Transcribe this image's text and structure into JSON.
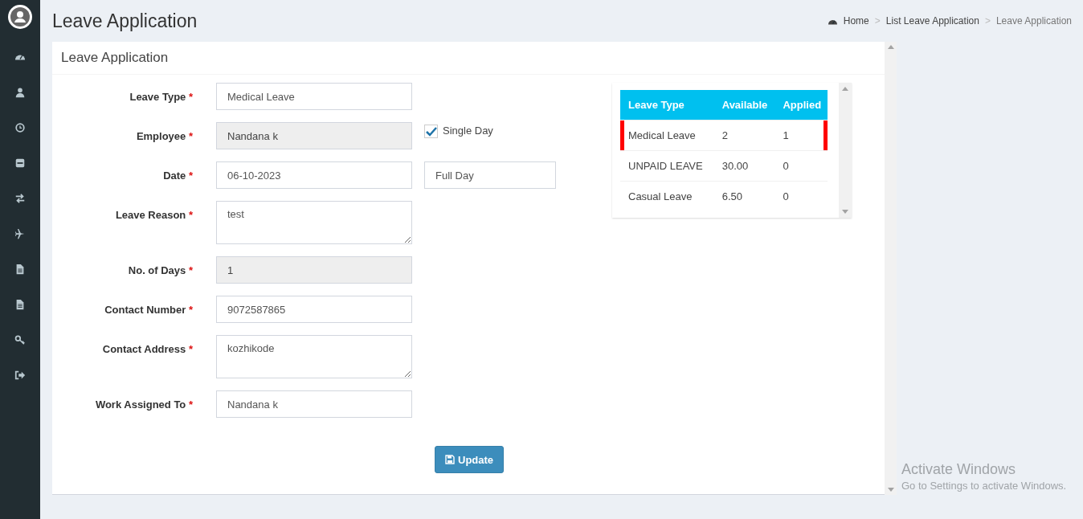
{
  "page_title": "Leave Application",
  "breadcrumb": [
    {
      "label": "Home",
      "kind": "link"
    },
    {
      "label": "List Leave Application",
      "kind": "link"
    },
    {
      "label": "Leave Application",
      "kind": "current"
    }
  ],
  "breadcrumb_separator": ">",
  "card_title": "Leave Application",
  "required_mark": "*",
  "fields": [
    {
      "label": "Leave Type",
      "kind": "input",
      "value": "Medical Leave",
      "disabled": false
    },
    {
      "label": "Employee",
      "kind": "input",
      "value": "Nandana k",
      "disabled": true,
      "checkbox": {
        "label": "Single Day",
        "checked": true
      }
    },
    {
      "label": "Date",
      "kind": "input",
      "value": "06-10-2023",
      "disabled": false,
      "extra_field": "Full Day"
    },
    {
      "label": "Leave Reason",
      "kind": "textarea",
      "value": "test",
      "disabled": false
    },
    {
      "label": "No. of Days",
      "kind": "input",
      "value": "1",
      "disabled": true
    },
    {
      "label": "Contact Number",
      "kind": "input",
      "value": "9072587865",
      "disabled": false
    },
    {
      "label": "Contact Address",
      "kind": "textarea",
      "value": "kozhikode",
      "disabled": false
    },
    {
      "label": "Work Assigned To",
      "kind": "input",
      "value": "Nandana k",
      "disabled": false
    }
  ],
  "update_button": "Update",
  "balance_table": {
    "columns": [
      "Leave Type",
      "Available",
      "Applied"
    ],
    "rows": [
      {
        "cells": [
          "Medical Leave",
          "2",
          "1"
        ],
        "selected": true
      },
      {
        "cells": [
          "UNPAID LEAVE",
          "30.00",
          "0"
        ],
        "selected": false
      },
      {
        "cells": [
          "Casual Leave",
          "6.50",
          "0"
        ],
        "selected": false
      }
    ]
  },
  "os_notice": {
    "title": "Activate Windows",
    "text": "Go to Settings to activate Windows."
  }
}
